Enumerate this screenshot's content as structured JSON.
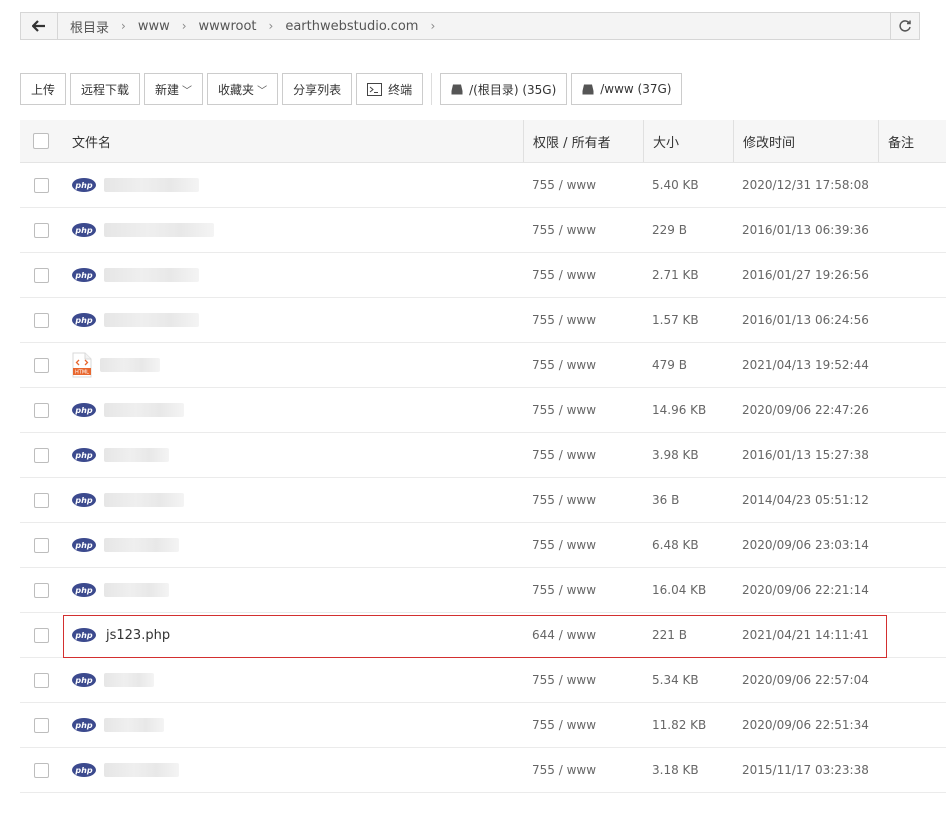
{
  "path": {
    "crumbs": [
      "根目录",
      "www",
      "wwwroot",
      "earthwebstudio.com"
    ],
    "separator": "›"
  },
  "toolbar": {
    "upload": "上传",
    "remote_download": "远程下载",
    "new": "新建",
    "favorites": "收藏夹",
    "share_list": "分享列表",
    "terminal": "终端",
    "disk_root": "/(根目录) (35G)",
    "disk_www": "/www (37G)"
  },
  "table": {
    "headers": {
      "name": "文件名",
      "perm": "权限 / 所有者",
      "size": "大小",
      "time": "修改时间",
      "note": "备注"
    },
    "rows": [
      {
        "icon": "php",
        "name": "",
        "perm": "755 / www",
        "size": "5.40 KB",
        "time": "2020/12/31 17:58:08"
      },
      {
        "icon": "php",
        "name": "",
        "perm": "755 / www",
        "size": "229 B",
        "time": "2016/01/13 06:39:36"
      },
      {
        "icon": "php",
        "name": "",
        "perm": "755 / www",
        "size": "2.71 KB",
        "time": "2016/01/27 19:26:56"
      },
      {
        "icon": "php",
        "name": "",
        "perm": "755 / www",
        "size": "1.57 KB",
        "time": "2016/01/13 06:24:56"
      },
      {
        "icon": "html",
        "name": "",
        "perm": "755 / www",
        "size": "479 B",
        "time": "2021/04/13 19:52:44"
      },
      {
        "icon": "php",
        "name": "",
        "perm": "755 / www",
        "size": "14.96 KB",
        "time": "2020/09/06 22:47:26"
      },
      {
        "icon": "php",
        "name": "",
        "perm": "755 / www",
        "size": "3.98 KB",
        "time": "2016/01/13 15:27:38"
      },
      {
        "icon": "php",
        "name": "",
        "perm": "755 / www",
        "size": "36 B",
        "time": "2014/04/23 05:51:12"
      },
      {
        "icon": "php",
        "name": "",
        "perm": "755 / www",
        "size": "6.48 KB",
        "time": "2020/09/06 23:03:14"
      },
      {
        "icon": "php",
        "name": "",
        "perm": "755 / www",
        "size": "16.04 KB",
        "time": "2020/09/06 22:21:14"
      },
      {
        "icon": "php",
        "name": "js123.php",
        "perm": "644 / www",
        "size": "221 B",
        "time": "2021/04/21 14:11:41"
      },
      {
        "icon": "php",
        "name": "",
        "perm": "755 / www",
        "size": "5.34 KB",
        "time": "2020/09/06 22:57:04"
      },
      {
        "icon": "php",
        "name": "",
        "perm": "755 / www",
        "size": "11.82 KB",
        "time": "2020/09/06 22:51:34"
      },
      {
        "icon": "php",
        "name": "",
        "perm": "755 / www",
        "size": "3.18 KB",
        "time": "2015/11/17 03:23:38"
      }
    ]
  },
  "icons": {
    "php_label": "php",
    "html_label": "HTML",
    "php_color": "#3c4a8e",
    "html_color": "#e8672f"
  },
  "highlight_color": "#d32f2f"
}
